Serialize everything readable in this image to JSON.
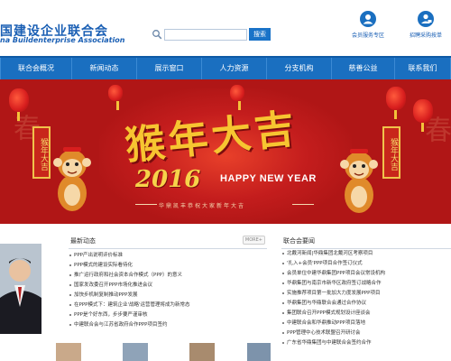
{
  "header": {
    "logo_cn": "国建设企业联合会",
    "logo_en": "na Buildenterprise Association",
    "search_placeholder": "",
    "search_button": "搜索",
    "links": [
      {
        "label": "会员服务专区"
      },
      {
        "label": "招聘采购按单"
      }
    ]
  },
  "nav": {
    "items": [
      {
        "label": "联合会概况"
      },
      {
        "label": "新闻动态"
      },
      {
        "label": "展示窗口"
      },
      {
        "label": "人力资源"
      },
      {
        "label": "分支机构"
      },
      {
        "label": "慈善公益"
      },
      {
        "label": "联系我们"
      }
    ]
  },
  "banner": {
    "title": "猴年大吉",
    "year": "2016",
    "hny": "HAPPY NEW YEAR",
    "greeting": "华鼎凯丰恭祝大家新年大吉",
    "scroll_left": "猴年大吉",
    "scroll_right": "猴年大吉"
  },
  "latest_news": {
    "title": "最新动态",
    "more": "MORE+",
    "items": [
      "PPP产出说明评价标准",
      "PPP模式的建设实际看待化",
      "推广运行政府和社会资本合作模式（PPP）的意义",
      "国家发改委召开PPP市场化推进会议",
      "加快步机制复制推动PPP发展",
      "在PPP模式下：建筑企业'战略'运营管理将成为新常态",
      "PPP是个好东西，步步要严谨审核",
      "中建联合会与江苏省政府合作PPP项目签约"
    ]
  },
  "member_news": {
    "title": "联合会要闻",
    "items": [
      "北戴河新闻|华鼎集团北戴河区考察项目",
      "'扎入+会员'PPP项目合作签订仪式",
      "会员单位中建华鼎集团PPP项目会议常设机构",
      "华鼎集团与南京市新华区政府签订战略合作",
      "实施推荐项目第一批加大力度发展PPP项目",
      "华鼎集团与华鼎联合会通过合作协议",
      "集团联合召开PPP模式规划设计座谈会",
      "中建联合会和华鼎推动PPP项目落地",
      "PPP管理中心技术联盟召开研讨会",
      "广东省华鼎集团与中建联合会签约合作"
    ]
  },
  "colors": {
    "brand_blue": "#1a6fc0",
    "banner_red": "#b01616",
    "gold": "#f7c531"
  },
  "icons": {
    "search": "search-icon",
    "member": "member-icon",
    "recruit": "recruit-icon"
  }
}
